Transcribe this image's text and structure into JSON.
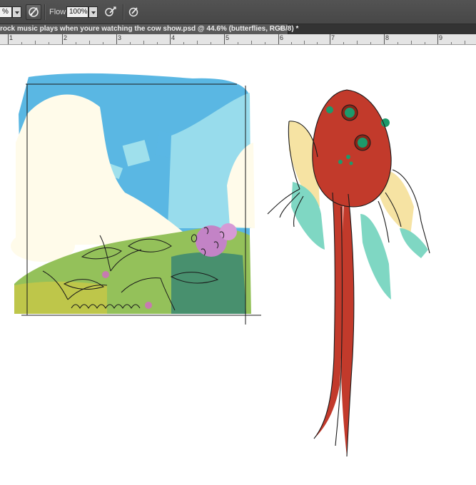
{
  "options_bar": {
    "opacity_value": "%",
    "flow_label": "Flow:",
    "flow_value": "100%"
  },
  "document_tab": {
    "title": "rock music plays when youre watching the cow show.psd @ 44.6% (butterflies, RGB/8) *",
    "close_symbol": "×"
  },
  "ruler": {
    "labels": [
      "1",
      "2",
      "3",
      "4",
      "5",
      "6",
      "7",
      "8",
      "9"
    ]
  },
  "colors": {
    "sky": "#5ab7e3",
    "sky_light": "#9fe0ec",
    "cloud": "#fffbea",
    "grass": "#94c15a",
    "creature_body": "#c23a2b",
    "wing_teal": "#7fd7c3",
    "wing_yellow": "#f6e3a3",
    "eye": "#1d9a6b"
  }
}
